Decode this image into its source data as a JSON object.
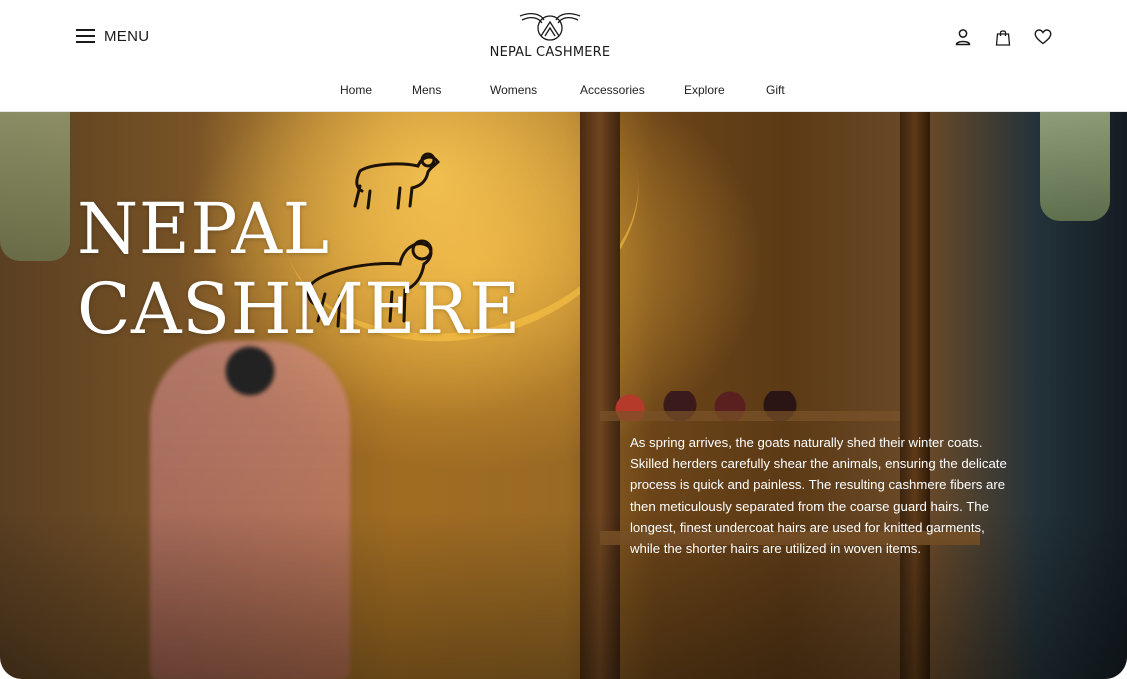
{
  "header": {
    "menu_label": "MENU",
    "logo_text": "NEPAL CASHMERE",
    "icons": [
      "user-icon",
      "shopping-bag-icon",
      "heart-icon"
    ]
  },
  "nav": {
    "items": [
      "Home",
      "Mens",
      "Womens",
      "Accessories",
      "Explore",
      "Gift"
    ]
  },
  "hero": {
    "title_line1": "NEPAL",
    "title_line2": "CASHMERE",
    "description": "As spring arrives, the goats naturally shed their winter coats. Skilled herders carefully shear the animals, ensuring the delicate process is quick and painless. The resulting cashmere fibers are then meticulously separated from the coarse guard hairs. The longest, finest undercoat hairs are used for knitted garments, while the shorter hairs are utilized in woven items.",
    "background_accent": "#e8b040"
  }
}
